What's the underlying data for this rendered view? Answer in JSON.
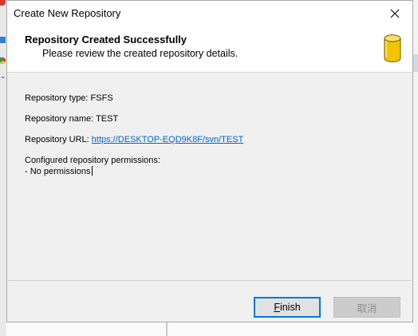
{
  "dialog": {
    "title": "Create New Repository",
    "header": {
      "title": "Repository Created Successfully",
      "subtitle": "Please review the created repository details.",
      "icon": "database-cylinder-icon"
    },
    "details": {
      "type_label": "Repository type: ",
      "type_value": "FSFS",
      "name_label": "Repository name: ",
      "name_value": "TEST",
      "url_label": "Repository URL: ",
      "url_value": "https://DESKTOP-EQD9K8F/svn/TEST",
      "permissions_label": "Configured repository permissions:",
      "permissions_value": "- No permissions"
    },
    "buttons": {
      "finish_mnemonic": "F",
      "finish_rest": "inish",
      "cancel": "取消"
    },
    "colors": {
      "link": "#0066cc",
      "focus_border": "#0078d7",
      "icon_fill": "#f5c400"
    }
  }
}
